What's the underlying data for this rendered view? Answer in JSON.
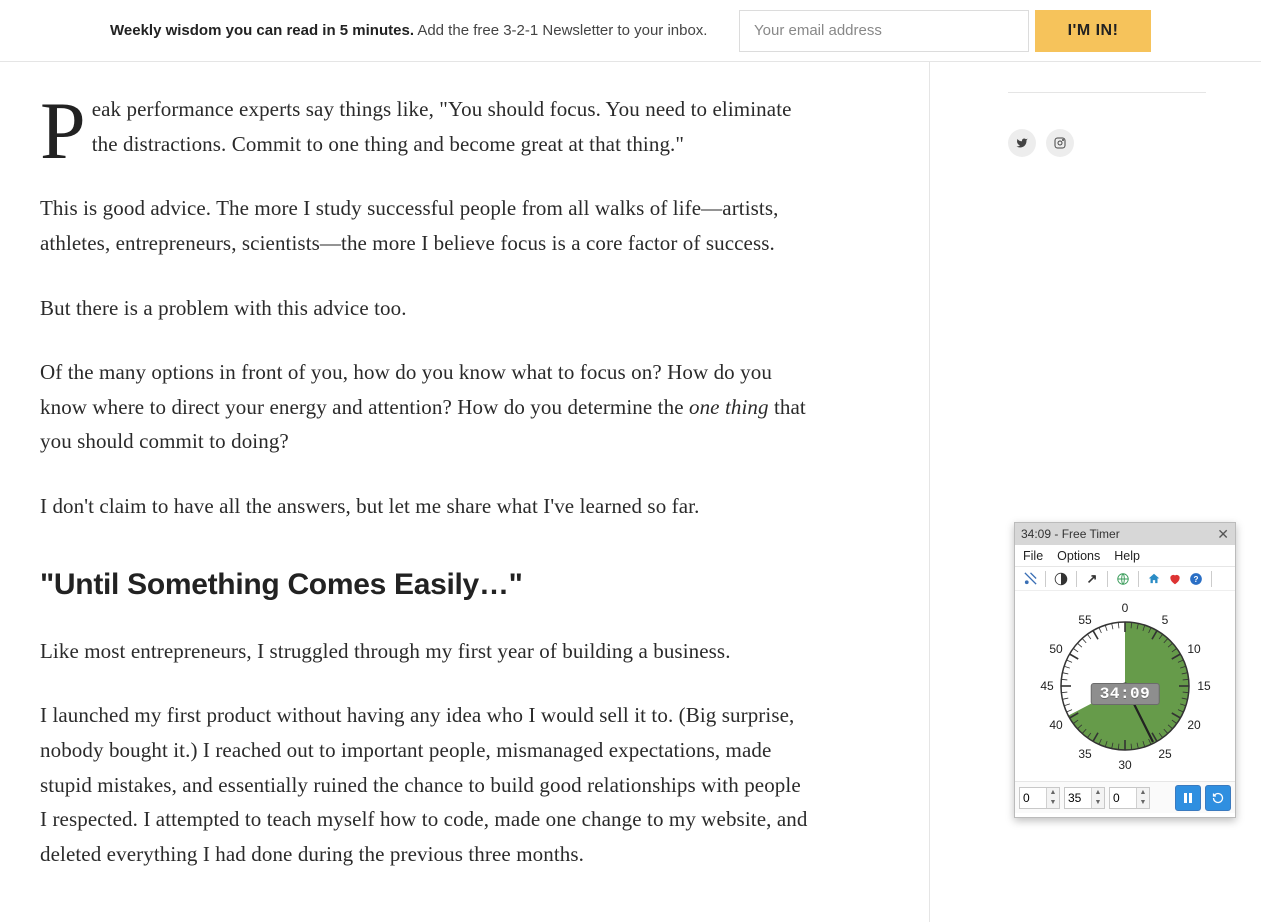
{
  "header": {
    "bold": "Weekly wisdom you can read in 5 minutes.",
    "rest": " Add the free 3-2-1 Newsletter to your inbox.",
    "email_placeholder": "Your email address",
    "submit_label": "I'M IN!"
  },
  "article": {
    "dropcap": "P",
    "p1_after_dropcap": "eak performance experts say things like, \"You should focus. You need to eliminate the distractions. Commit to one thing and become great at that thing.\"",
    "p2": "This is good advice. The more I study successful people from all walks of life—artists, athletes, entrepreneurs, scientists—the more I believe focus is a core factor of success.",
    "p3": "But there is a problem with this advice too.",
    "p4_a": "Of the many options in front of you, how do you know what to focus on? How do you know where to direct your energy and attention? How do you determine the ",
    "p4_em": "one thing",
    "p4_b": " that you should commit to doing?",
    "p5": "I don't claim to have all the answers, but let me share what I've learned so far.",
    "h2": "\"Until Something Comes Easily…\"",
    "p6": "Like most entrepreneurs, I struggled through my first year of building a business.",
    "p7": "I launched my first product without having any idea who I would sell it to. (Big surprise, nobody bought it.) I reached out to important people, mismanaged expectations, made stupid mistakes, and essentially ruined the chance to build good relationships with people I respected. I attempted to teach myself how to code, made one change to my website, and deleted everything I had done during the previous three months."
  },
  "social": {
    "twitter": "twitter-icon",
    "instagram": "instagram-icon"
  },
  "timer": {
    "title": "34:09 - Free Timer",
    "menu": {
      "file": "File",
      "options": "Options",
      "help": "Help"
    },
    "digital": "34:09",
    "dial_numbers": [
      "0",
      "5",
      "10",
      "15",
      "20",
      "25",
      "30",
      "35",
      "40",
      "45",
      "50",
      "55"
    ],
    "input_hours": "0",
    "input_minutes": "35",
    "input_seconds": "0"
  }
}
